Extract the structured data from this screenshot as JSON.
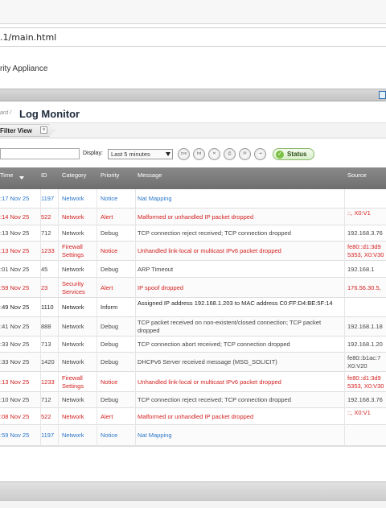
{
  "browser": {
    "url_fragment": ".1/main.html"
  },
  "app": {
    "name_fragment": "rity Appliance"
  },
  "breadcrumb": {
    "prefix": "ard /",
    "title": "Log Monitor"
  },
  "tabs": [
    {
      "label": "Filter View",
      "close": "×"
    }
  ],
  "toolbar": {
    "search_value": "",
    "display_label": "Display:",
    "display_value": "Last 5 minutes",
    "tools": [
      {
        "name": "csv-export-icon",
        "text": "csv"
      },
      {
        "name": "txt-export-icon",
        "text": "txt"
      },
      {
        "name": "clear-log-icon",
        "text": "✕"
      },
      {
        "name": "print-icon",
        "text": "⎙"
      },
      {
        "name": "email-log-icon",
        "text": "✉"
      },
      {
        "name": "export-log-icon",
        "text": "⇥"
      }
    ],
    "status_label": "Status"
  },
  "table": {
    "columns": [
      "Time",
      "ID",
      "Category",
      "Priority",
      "Message",
      "Source"
    ],
    "rows": [
      {
        "time": ":17 Nov 25",
        "id": "1197",
        "category": "Network",
        "priority": "Notice",
        "message": "Nat Mapping",
        "source": "",
        "color": "blue"
      },
      {
        "time": ":14 Nov 25",
        "id": "522",
        "category": "Network",
        "priority": "Alert",
        "message": "Malformed or unhandled IP packet dropped",
        "source": "::, X0:V1",
        "color": "red"
      },
      {
        "time": ":13 Nov 25",
        "id": "712",
        "category": "Network",
        "priority": "Debug",
        "message": "TCP connection reject received; TCP connection dropped",
        "source": "192.168.3.76",
        "color": "grey"
      },
      {
        "time": ":13 Nov 25",
        "id": "1233",
        "category": "Firewall Settings",
        "priority": "Notice",
        "message": "Unhandled link-local or multicast IPv6 packet dropped",
        "source": "fe80::d1:3d9 5353, X0:V30",
        "color": "red"
      },
      {
        "time": ":01 Nov 25",
        "id": "45",
        "category": "Network",
        "priority": "Debug",
        "message": "ARP Timeout",
        "source": "192.168.1",
        "color": "grey"
      },
      {
        "time": ":59 Nov 25",
        "id": "23",
        "category": "Security Services",
        "priority": "Alert",
        "message": "IP spoof dropped",
        "source": "176.56.30.5,",
        "color": "red"
      },
      {
        "time": ":49 Nov 25",
        "id": "1110",
        "category": "Network",
        "priority": "Inform",
        "message": "Assigned IP address 192.168.1.203 to MAC address C0:FF:D4:BE:5F:14",
        "source": "",
        "color": "black"
      },
      {
        "time": ":41 Nov 25",
        "id": "888",
        "category": "Network",
        "priority": "Debug",
        "message": "TCP packet received on non-existent/closed connection; TCP packet dropped",
        "source": "192.168.1.18",
        "color": "grey"
      },
      {
        "time": ":33 Nov 25",
        "id": "713",
        "category": "Network",
        "priority": "Debug",
        "message": "TCP connection abort received; TCP connection dropped",
        "source": "192.168.1.20",
        "color": "grey"
      },
      {
        "time": ":33 Nov 25",
        "id": "1420",
        "category": "Network",
        "priority": "Debug",
        "message": "DHCPv6 Server received message (MSG_SOLICIT)",
        "source": "fe80::b1ac:7 X0:V20",
        "color": "grey"
      },
      {
        "time": ":13 Nov 25",
        "id": "1233",
        "category": "Firewall Settings",
        "priority": "Notice",
        "message": "Unhandled link-local or multicast IPv6 packet dropped",
        "source": "fe80::d1:3d9 5353, X0:V30",
        "color": "red"
      },
      {
        "time": ":10 Nov 25",
        "id": "712",
        "category": "Network",
        "priority": "Debug",
        "message": "TCP connection reject received; TCP connection dropped",
        "source": "192.168.3.76",
        "color": "grey"
      },
      {
        "time": ":08 Nov 25",
        "id": "522",
        "category": "Network",
        "priority": "Alert",
        "message": "Malformed or unhandled IP packet dropped",
        "source": "::, X0:V1",
        "color": "red"
      },
      {
        "time": ":59 Nov 25",
        "id": "1197",
        "category": "Network",
        "priority": "Notice",
        "message": "Nat Mapping",
        "source": "",
        "color": "blue"
      }
    ]
  }
}
